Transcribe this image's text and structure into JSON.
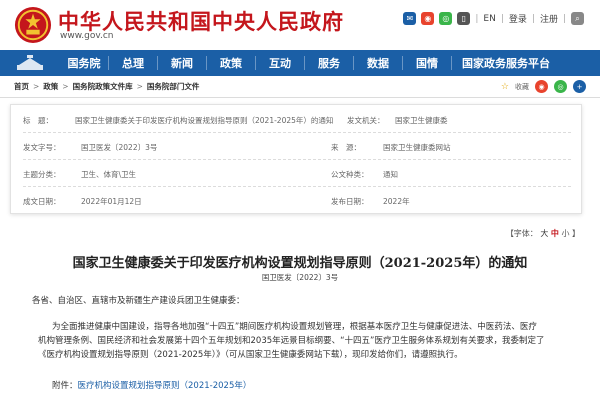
{
  "header": {
    "site_title": "中华人民共和国中央人民政府",
    "site_url": "www.gov.cn",
    "tools": {
      "lang_en": "EN",
      "login": "登录",
      "register": "注册",
      "sep": "|"
    }
  },
  "nav": {
    "items": [
      "国务院",
      "总理",
      "新闻",
      "政策",
      "互动",
      "服务",
      "数据",
      "国情",
      "国家政务服务平台"
    ]
  },
  "breadcrumb": {
    "items": [
      "首页",
      "政策",
      "国务院政策文件库",
      "国务院部门文件"
    ],
    "separator": ">",
    "share_label": "收藏"
  },
  "meta": {
    "rows": [
      {
        "label": "标　题：",
        "value": "国家卫生健康委关于印发医疗机构设置规划指导原则（2021-2025年）的通知",
        "label2": "发文机关：",
        "value2": "国家卫生健康委"
      },
      {
        "label": "发文字号：",
        "value": "国卫医发〔2022〕3号",
        "label2": "来　源：",
        "value2": "国家卫生健康委网站"
      },
      {
        "label": "主题分类：",
        "value": "卫生、体育\\卫生",
        "label2": "公文种类：",
        "value2": "通知"
      },
      {
        "label": "成文日期：",
        "value": "2022年01月12日",
        "label2": "发布日期：",
        "value2": "2022年"
      }
    ]
  },
  "font_size": {
    "label": "【字体：",
    "large": "大",
    "mid": "中",
    "small": "小",
    "close": "】"
  },
  "document": {
    "title": "国家卫生健康委关于印发医疗机构设置规划指导原则（2021-2025年）的通知",
    "number": "国卫医发〔2022〕3号",
    "addressee": "各省、自治区、直辖市及新疆生产建设兵团卫生健康委：",
    "paragraph_line1": "为全面推进健康中国建设，指导各地加强“十四五”期间医疗机构设置规划管理，根据基本医疗卫生与健康促进法、中医药法、医疗",
    "paragraph_line2": "机构管理条例、国民经济和社会发展第十四个五年规划和2035年远景目标纲要、“十四五”医疗卫生服务体系规划有关要求，我委制定了",
    "paragraph_line3": "《医疗机构设置规划指导原则（2021-2025年）》（可从国家卫生健康委网站下载），现印发给你们，请遵照执行。",
    "attachment_label": "附件：",
    "attachment_link": "医疗机构设置规划指导原则（2021-2025年）"
  },
  "colors": {
    "brand_red": "#c4161c",
    "nav_blue": "#1b5fa6"
  }
}
